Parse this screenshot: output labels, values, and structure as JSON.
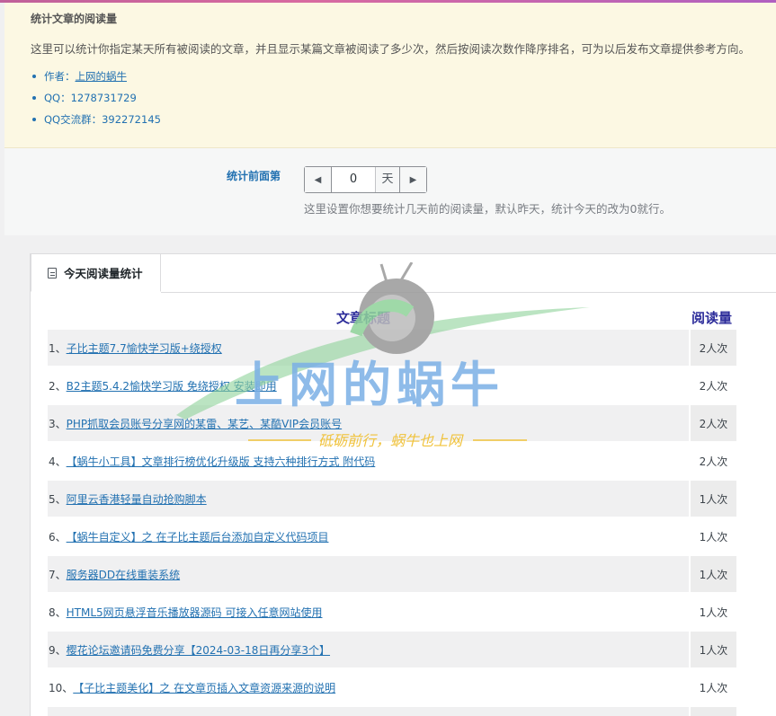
{
  "notice": {
    "title": "统计文章的阅读量",
    "description": "这里可以统计你指定某天所有被阅读的文章，并且显示某篇文章被阅读了多少次，然后按阅读次数作降序排名，可为以后发布文章提供参考方向。",
    "author_prefix": "作者：",
    "author_link": "上网的蜗牛",
    "qq": "QQ：1278731729",
    "qq_group": "QQ交流群：392272145"
  },
  "settings": {
    "label": "统计前面第",
    "days_value": "0",
    "unit": "天",
    "hint": "这里设置你想要统计几天前的阅读量，默认昨天，统计今天的改为0就行。"
  },
  "tab": {
    "label": "今天阅读量统计"
  },
  "table": {
    "col_title": "文章标题",
    "col_reads": "阅读量",
    "rows": [
      {
        "num": "1、",
        "title": "子比主题7.7愉快学习版+绕授权",
        "reads": "2人次"
      },
      {
        "num": "2、",
        "title": "B2主题5.4.2愉快学习版 免绕授权 安装即用",
        "reads": "2人次"
      },
      {
        "num": "3、",
        "title": "PHP抓取会员账号分享网的某雷、某艺、某酷VIP会员账号",
        "reads": "2人次"
      },
      {
        "num": "4、",
        "title": "【蜗牛小工具】文章排行榜优化升级版 支持六种排行方式 附代码",
        "reads": "2人次"
      },
      {
        "num": "5、",
        "title": "阿里云香港轻量自动抢购脚本",
        "reads": "1人次"
      },
      {
        "num": "6、",
        "title": "【蜗牛自定义】之 在子比主题后台添加自定义代码项目",
        "reads": "1人次"
      },
      {
        "num": "7、",
        "title": "服务器DD在线重装系统",
        "reads": "1人次"
      },
      {
        "num": "8、",
        "title": "HTML5网页悬浮音乐播放器源码 可接入任意网站使用",
        "reads": "1人次"
      },
      {
        "num": "9、",
        "title": "樱花论坛邀请码免费分享【2024-03-18日再分享3个】",
        "reads": "1人次"
      },
      {
        "num": "10、",
        "title": "【子比主题美化】之 在文章页插入文章资源来源的说明",
        "reads": "1人次"
      }
    ]
  },
  "watermark": {
    "main_text": "上网的蜗牛",
    "sub_text": "砥砺前行，蜗牛也上网"
  },
  "colors": {
    "notice_bg": "#fcf8e3",
    "link": "#2271b1",
    "header_text": "#2c2c9a",
    "watermark_blue": "#7bb0e6",
    "watermark_green": "#8fd39a",
    "watermark_gold": "#f0c23a"
  }
}
